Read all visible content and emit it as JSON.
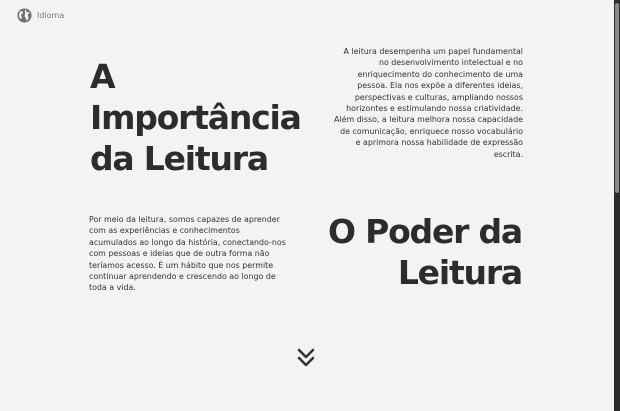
{
  "language": {
    "label": "Idioma",
    "icon": "globe-icon"
  },
  "section1": {
    "title": "A Importância da Leitura",
    "text": "A leitura desempenha um papel fundamental no desenvolvimento intelectual e no enriquecimento do conhecimento de uma pessoa. Ela nos expõe a diferentes ideias, perspectivas e culturas, ampliando nossos horizontes e estimulando nossa criatividade. Além disso, a leitura melhora nossa capacidade de comunicação, enriquece nosso vocabulário e aprimora nossa habilidade de expressão escrita."
  },
  "section2": {
    "title": "O Poder da Leitura",
    "text": "Por meio da leitura, somos capazes de aprender com as experiências e conhecimentos acumulados ao longo da história, conectando-nos com pessoas e ideias que de outra forma não teríamos acesso. É um hábito que nos permite continuar aprendendo e crescendo ao longo de toda a vida."
  },
  "scroll_indicator": {
    "icon": "double-chevron-down-icon"
  },
  "colors": {
    "background": "#f3f3f3",
    "heading": "#2c2c2c",
    "text": "#333333",
    "muted": "#777777"
  }
}
